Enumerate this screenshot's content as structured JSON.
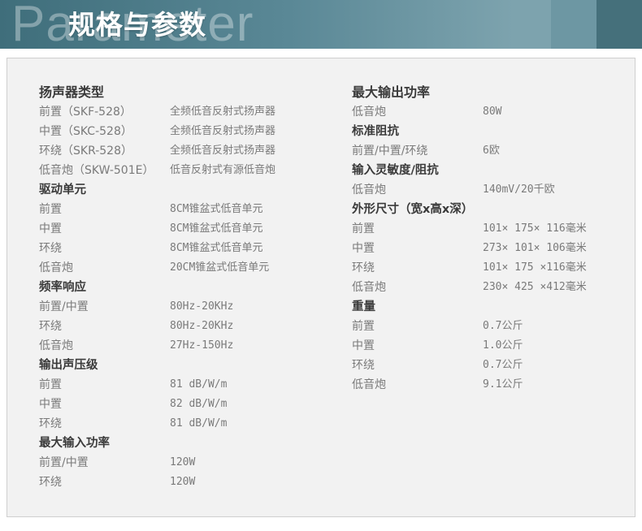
{
  "header": {
    "watermark": "Parameter",
    "title": "规格与参数"
  },
  "left_column": [
    {
      "type": "heading",
      "label": "扬声器类型"
    },
    {
      "type": "row",
      "label": "前置（SKF-528）",
      "value": "全频低音反射式扬声器"
    },
    {
      "type": "row",
      "label": "中置（SKC-528）",
      "value": "全频低音反射式扬声器"
    },
    {
      "type": "row",
      "label": "环绕（SKR-528）",
      "value": "全频低音反射式扬声器"
    },
    {
      "type": "row",
      "label": "低音炮（SKW-501E）",
      "value": "低音反射式有源低音炮"
    },
    {
      "type": "heading",
      "label": "驱动单元"
    },
    {
      "type": "row",
      "label": "前置",
      "value": "8CM锥盆式低音单元"
    },
    {
      "type": "row",
      "label": "中置",
      "value": "8CM锥盆式低音单元"
    },
    {
      "type": "row",
      "label": "环绕",
      "value": "8CM锥盆式低音单元"
    },
    {
      "type": "row",
      "label": "低音炮",
      "value": "20CM锥盆式低音单元"
    },
    {
      "type": "heading",
      "label": "频率响应"
    },
    {
      "type": "row",
      "label": "前置/中置",
      "value": "80Hz-20KHz"
    },
    {
      "type": "row",
      "label": "环绕",
      "value": "80Hz-20KHz"
    },
    {
      "type": "row",
      "label": "低音炮",
      "value": "27Hz-150Hz"
    },
    {
      "type": "heading",
      "label": "输出声压级"
    },
    {
      "type": "row",
      "label": "前置",
      "value": "81 dB/W/m"
    },
    {
      "type": "row",
      "label": "中置",
      "value": "82 dB/W/m"
    },
    {
      "type": "row",
      "label": "环绕",
      "value": "81 dB/W/m"
    },
    {
      "type": "heading",
      "label": "最大输入功率"
    },
    {
      "type": "row",
      "label": "前置/中置",
      "value": "120W"
    },
    {
      "type": "row",
      "label": "环绕",
      "value": "120W"
    }
  ],
  "right_column": [
    {
      "type": "heading",
      "label": "最大输出功率"
    },
    {
      "type": "row",
      "label": "低音炮",
      "value": "80W"
    },
    {
      "type": "heading",
      "label": "标准阻抗"
    },
    {
      "type": "row",
      "label": "前置/中置/环绕",
      "value": "6欧"
    },
    {
      "type": "heading",
      "label": "输入灵敏度/阻抗"
    },
    {
      "type": "row",
      "label": "低音炮",
      "value": "140mV/20千欧"
    },
    {
      "type": "heading",
      "label": "外形尺寸（宽x高x深）"
    },
    {
      "type": "row",
      "label": "前置",
      "value": "101× 175× 116毫米"
    },
    {
      "type": "row",
      "label": "中置",
      "value": "273× 101× 106毫米"
    },
    {
      "type": "row",
      "label": "环绕",
      "value": "101× 175 ×116毫米"
    },
    {
      "type": "row",
      "label": "低音炮",
      "value": "230× 425 ×412毫米"
    },
    {
      "type": "heading",
      "label": "重量"
    },
    {
      "type": "row",
      "label": "前置",
      "value": "0.7公斤"
    },
    {
      "type": "row",
      "label": "中置",
      "value": "1.0公斤"
    },
    {
      "type": "row",
      "label": "环绕",
      "value": "0.7公斤"
    },
    {
      "type": "row",
      "label": "低音炮",
      "value": "9.1公斤"
    }
  ]
}
